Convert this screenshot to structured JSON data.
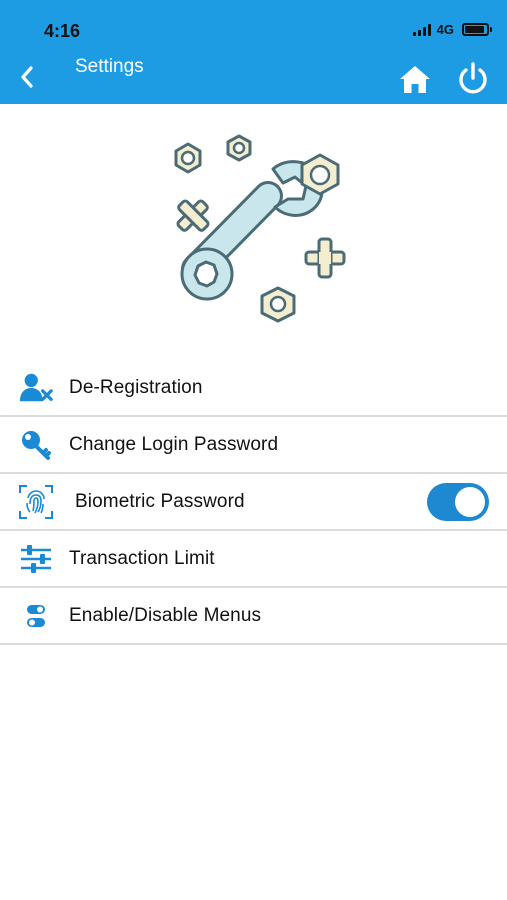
{
  "status_bar": {
    "time": "4:16",
    "network": "4G"
  },
  "header": {
    "title": "Settings"
  },
  "menu": {
    "items": [
      {
        "label": "De-Registration",
        "icon": "user-remove-icon"
      },
      {
        "label": "Change Login Password",
        "icon": "key-icon"
      },
      {
        "label": "Biometric Password",
        "icon": "fingerprint-icon",
        "toggle_on": true
      },
      {
        "label": "Transaction Limit",
        "icon": "sliders-icon"
      },
      {
        "label": "Enable/Disable Menus",
        "icon": "toggles-icon"
      }
    ]
  },
  "colors": {
    "header": "#1e9ce3",
    "accent": "#1e88d0",
    "icon": "#1a8ad4",
    "illustration_fill": "#c9e6ec",
    "illustration_stroke": "#4b6b76",
    "nut_fill": "#f4edcf"
  }
}
